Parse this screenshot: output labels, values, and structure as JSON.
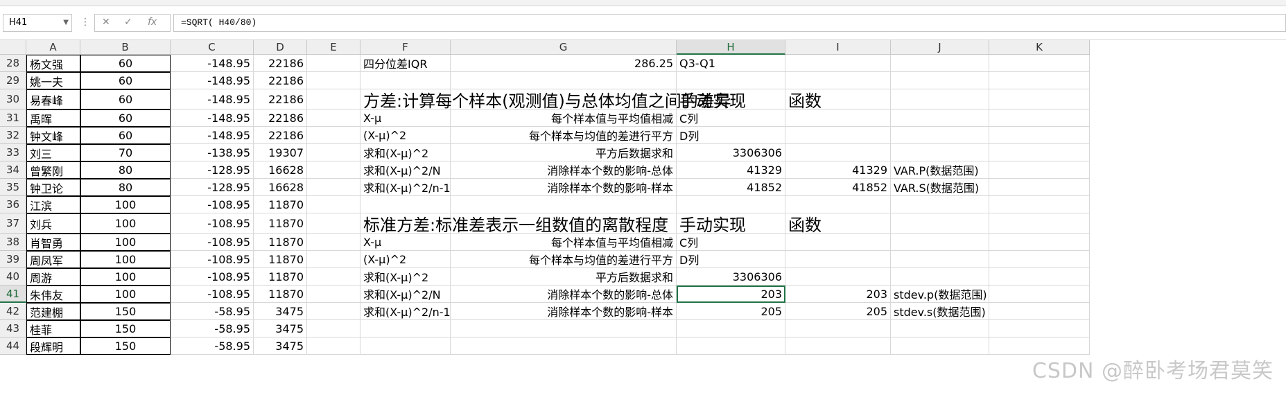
{
  "formula_bar": {
    "name_box": "H41",
    "fx_symbol": "fx",
    "cancel_symbol": "✕",
    "enter_symbol": "✓",
    "formula": "=SQRT( H40/80)"
  },
  "columns": [
    "A",
    "B",
    "C",
    "D",
    "E",
    "F",
    "G",
    "H",
    "I",
    "J",
    "K"
  ],
  "selected_column": "H",
  "selected_row": "41",
  "rows": [
    {
      "num": "28",
      "A": "杨文强",
      "B": "60",
      "C": "-148.95",
      "D": "22186",
      "F": "四分位差IQR",
      "G": "286.25",
      "H": "Q3-Q1"
    },
    {
      "num": "29",
      "A": "姚一夫",
      "B": "60",
      "C": "-148.95",
      "D": "22186"
    },
    {
      "num": "30",
      "A": "易春峰",
      "B": "60",
      "C": "-148.95",
      "D": "22186",
      "F": "方差:计算每个样本(观测值)与总体均值之间的差异",
      "H": "手动实现",
      "I": "函数"
    },
    {
      "num": "31",
      "A": "禹晖",
      "B": "60",
      "C": "-148.95",
      "D": "22186",
      "F": "X-μ",
      "G": "每个样本值与平均值相减",
      "H": "C列"
    },
    {
      "num": "32",
      "A": "钟文峰",
      "B": "60",
      "C": "-148.95",
      "D": "22186",
      "F": "(X-μ)^2",
      "G": "每个样本与均值的差进行平方",
      "H": "D列"
    },
    {
      "num": "33",
      "A": "刘三",
      "B": "70",
      "C": "-138.95",
      "D": "19307",
      "F": "求和(X-μ)^2",
      "G": "平方后数据求和",
      "H": "3306306"
    },
    {
      "num": "34",
      "A": "曾繁刚",
      "B": "80",
      "C": "-128.95",
      "D": "16628",
      "F": "求和(X-μ)^2/N",
      "G": "消除样本个数的影响-总体",
      "H": "41329",
      "I": "41329",
      "J": "VAR.P(数据范围)"
    },
    {
      "num": "35",
      "A": "钟卫论",
      "B": "80",
      "C": "-128.95",
      "D": "16628",
      "F": "求和(X-μ)^2/n-1",
      "G": "消除样本个数的影响-样本",
      "H": "41852",
      "I": "41852",
      "J": "VAR.S(数据范围)"
    },
    {
      "num": "36",
      "A": "江滨",
      "B": "100",
      "C": "-108.95",
      "D": "11870"
    },
    {
      "num": "37",
      "A": "刘兵",
      "B": "100",
      "C": "-108.95",
      "D": "11870",
      "F": "标准方差:标准差表示一组数值的离散程度",
      "H": "手动实现",
      "I": "函数"
    },
    {
      "num": "38",
      "A": "肖智勇",
      "B": "100",
      "C": "-108.95",
      "D": "11870",
      "F": "X-μ",
      "G": "每个样本值与平均值相减",
      "H": "C列"
    },
    {
      "num": "39",
      "A": "周凤军",
      "B": "100",
      "C": "-108.95",
      "D": "11870",
      "F": "(X-μ)^2",
      "G": "每个样本与均值的差进行平方",
      "H": "D列"
    },
    {
      "num": "40",
      "A": "周游",
      "B": "100",
      "C": "-108.95",
      "D": "11870",
      "F": "求和(X-μ)^2",
      "G": "平方后数据求和",
      "H": "3306306"
    },
    {
      "num": "41",
      "A": "朱伟友",
      "B": "100",
      "C": "-108.95",
      "D": "11870",
      "F": "求和(X-μ)^2/N",
      "G": "消除样本个数的影响-总体",
      "H": "203",
      "I": "203",
      "J": "stdev.p(数据范围)"
    },
    {
      "num": "42",
      "A": "范建棚",
      "B": "150",
      "C": "-58.95",
      "D": "3475",
      "F": "求和(X-μ)^2/n-1",
      "G": "消除样本个数的影响-样本",
      "H": "205",
      "I": "205",
      "J": "stdev.s(数据范围)"
    },
    {
      "num": "43",
      "A": "桂菲",
      "B": "150",
      "C": "-58.95",
      "D": "3475"
    },
    {
      "num": "44",
      "A": "段辉明",
      "B": "150",
      "C": "-58.95",
      "D": "3475"
    }
  ],
  "watermark": "CSDN @醉卧考场君莫笑",
  "accent_color": "#217346"
}
